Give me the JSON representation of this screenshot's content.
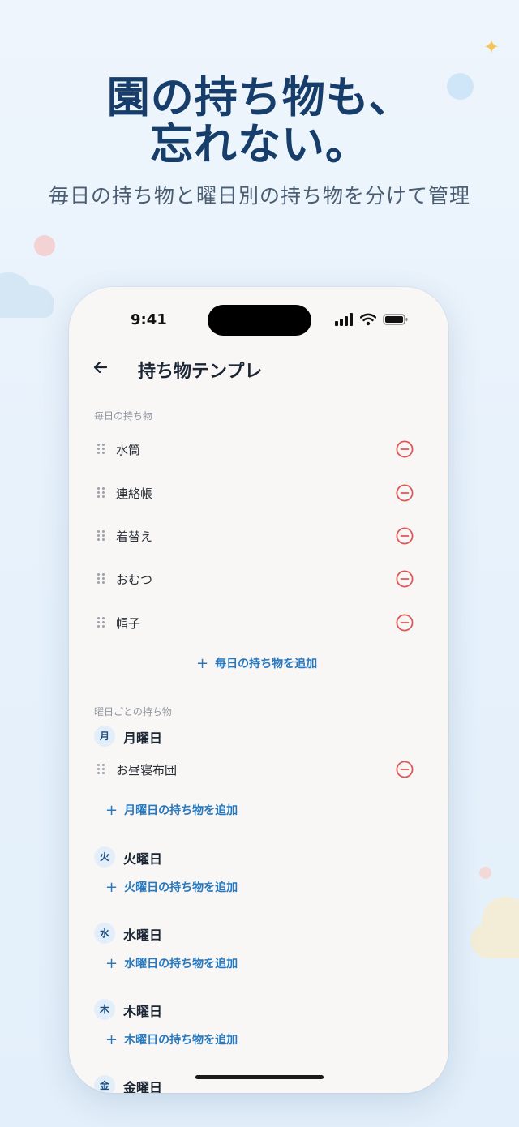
{
  "promo": {
    "headline_line1": "園の持ち物も、",
    "headline_line2": "忘れない。",
    "subheadline": "毎日の持ち物と曜日別の持ち物を分けて管理"
  },
  "status_bar": {
    "time": "9:41"
  },
  "nav": {
    "title": "持ち物テンプレ"
  },
  "daily": {
    "section_label": "毎日の持ち物",
    "items": [
      {
        "label": "水筒"
      },
      {
        "label": "連絡帳"
      },
      {
        "label": "着替え"
      },
      {
        "label": "おむつ"
      },
      {
        "label": "帽子"
      }
    ],
    "add_label": "毎日の持ち物を追加"
  },
  "weekly": {
    "section_label": "曜日ごとの持ち物",
    "days": [
      {
        "badge": "月",
        "title": "月曜日",
        "items": [
          {
            "label": "お昼寝布団"
          }
        ],
        "add_label": "月曜日の持ち物を追加"
      },
      {
        "badge": "火",
        "title": "火曜日",
        "items": [],
        "add_label": "火曜日の持ち物を追加"
      },
      {
        "badge": "水",
        "title": "水曜日",
        "items": [],
        "add_label": "水曜日の持ち物を追加"
      },
      {
        "badge": "木",
        "title": "木曜日",
        "items": [],
        "add_label": "木曜日の持ち物を追加"
      },
      {
        "badge": "金",
        "title": "金曜日",
        "items": [],
        "add_label": ""
      }
    ]
  },
  "colors": {
    "accent": "#2778bf",
    "remove": "#e05555",
    "headline": "#173e6a"
  },
  "icons": {
    "back": "arrow-left-icon",
    "remove": "minus-circle-icon",
    "drag": "drag-handle-icon",
    "add": "plus-icon"
  }
}
